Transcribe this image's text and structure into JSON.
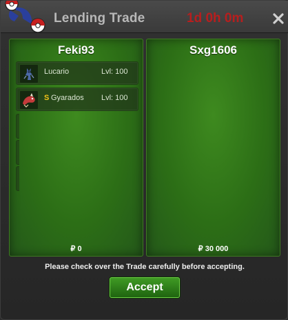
{
  "window": {
    "title": "Lending Trade",
    "timer": "1d 0h 0m",
    "logo_icon": "pokeball-logo-icon",
    "close_icon": "close-icon"
  },
  "left_panel": {
    "player": "Feki93",
    "money": "₽ 0",
    "slots": [
      {
        "pokemon": "Lucario",
        "level": "Lvl: 100",
        "icon": "lucario-sprite-icon",
        "shiny": ""
      },
      {
        "pokemon": "Gyarados",
        "level": "Lvl: 100",
        "icon": "gyarados-sprite-icon",
        "shiny": "S"
      }
    ]
  },
  "right_panel": {
    "player": "Sxg1606",
    "money": "₽ 30 000"
  },
  "notice": "Please check over the Trade carefully before accepting.",
  "accept_label": "Accept",
  "colors": {
    "panel_green": "#2c6e16",
    "timer_red": "#b71e1e",
    "title_gray": "#b8b8b8",
    "shiny_gold": "#f2c318"
  }
}
